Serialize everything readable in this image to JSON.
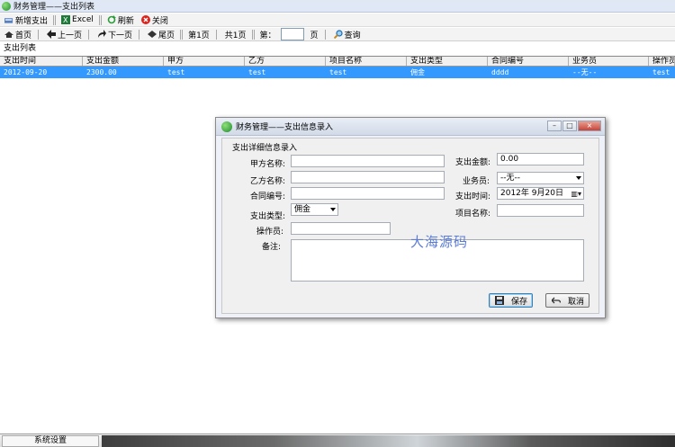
{
  "window": {
    "title": "财务管理——支出列表"
  },
  "toolbar1": {
    "new_label": "新增支出",
    "excel_label": "Excel",
    "refresh_label": "刷新",
    "close_label": "关闭"
  },
  "toolbar2": {
    "first_label": "首页",
    "prev_label": "上一页",
    "next_label": "下一页",
    "last_label": "尾页",
    "page_current": "第1页",
    "page_total": "共1页",
    "goto_prefix": "第：",
    "goto_suffix": "页",
    "query_label": "查询",
    "goto_value": ""
  },
  "list": {
    "title": "支出列表",
    "columns": [
      "支出时间",
      "支出金额",
      "甲方",
      "乙方",
      "项目名称",
      "支出类型",
      "合同编号",
      "业务员",
      "操作员"
    ],
    "rows": [
      [
        "2012-09-20",
        "2300.00",
        "test",
        "test",
        "test",
        "佣金",
        "dddd",
        "--无--",
        "test"
      ]
    ]
  },
  "dialog": {
    "title": "财务管理——支出信息录入",
    "group_title": "支出详细信息录入",
    "party_a_label": "甲方名称:",
    "party_a_value": "",
    "party_b_label": "乙方名称:",
    "party_b_value": "",
    "contract_label": "合同编号:",
    "contract_value": "",
    "type_label": "支出类型:",
    "type_value": "佣金",
    "operator_label": "操作员:",
    "operator_value": "",
    "note_label": "备注:",
    "note_value": "",
    "amount_label": "支出金额:",
    "amount_value": "0.00",
    "salesman_label": "业务员:",
    "salesman_value": "--无--",
    "date_label": "支出时间:",
    "date_value": "2012年  9月20日",
    "project_label": "项目名称:",
    "project_value": "",
    "save_label": "保存",
    "cancel_label": "取消"
  },
  "overlay": {
    "watermark_text": "大海源码"
  },
  "bottom": {
    "tab_label": "系统设置"
  },
  "colors": {
    "selection": "#3399ff",
    "titlebar": "#dfe8f4"
  }
}
